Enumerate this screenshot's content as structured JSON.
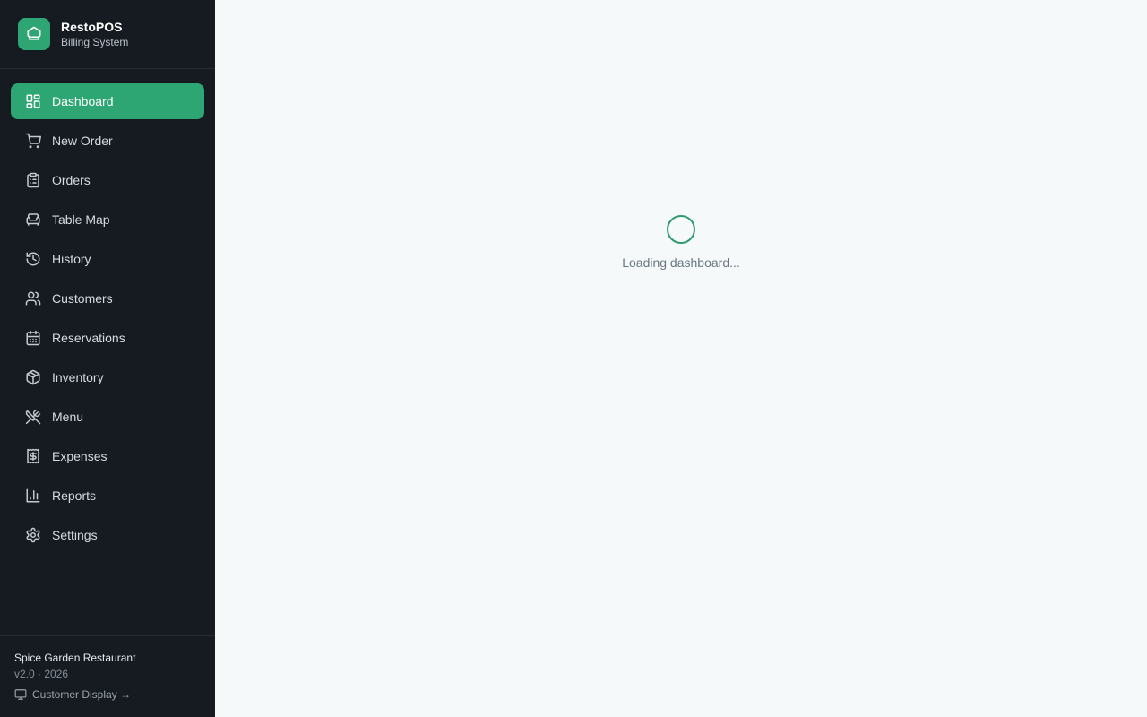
{
  "brand": {
    "title": "RestoPOS",
    "subtitle": "Billing System",
    "logo_icon": "chef-hat-icon",
    "accent_color": "#2ea673"
  },
  "nav": {
    "items": [
      {
        "label": "Dashboard",
        "icon": "layout-dashboard-icon",
        "active": true
      },
      {
        "label": "New Order",
        "icon": "shopping-cart-icon",
        "active": false
      },
      {
        "label": "Orders",
        "icon": "clipboard-list-icon",
        "active": false
      },
      {
        "label": "Table Map",
        "icon": "armchair-icon",
        "active": false
      },
      {
        "label": "History",
        "icon": "history-icon",
        "active": false
      },
      {
        "label": "Customers",
        "icon": "users-icon",
        "active": false
      },
      {
        "label": "Reservations",
        "icon": "calendar-icon",
        "active": false
      },
      {
        "label": "Inventory",
        "icon": "package-icon",
        "active": false
      },
      {
        "label": "Menu",
        "icon": "utensils-crossed-icon",
        "active": false
      },
      {
        "label": "Expenses",
        "icon": "receipt-icon",
        "active": false
      },
      {
        "label": "Reports",
        "icon": "bar-chart-icon",
        "active": false
      },
      {
        "label": "Settings",
        "icon": "gear-icon",
        "active": false
      }
    ]
  },
  "footer": {
    "restaurant_name": "Spice Garden Restaurant",
    "version": "v2.0 · 2026",
    "customer_display_label": "Customer Display →"
  },
  "main": {
    "loading_text": "Loading dashboard..."
  },
  "colors": {
    "sidebar_bg": "#161b22",
    "main_bg": "#f6f9fa",
    "spinner": "#2e9a72"
  }
}
